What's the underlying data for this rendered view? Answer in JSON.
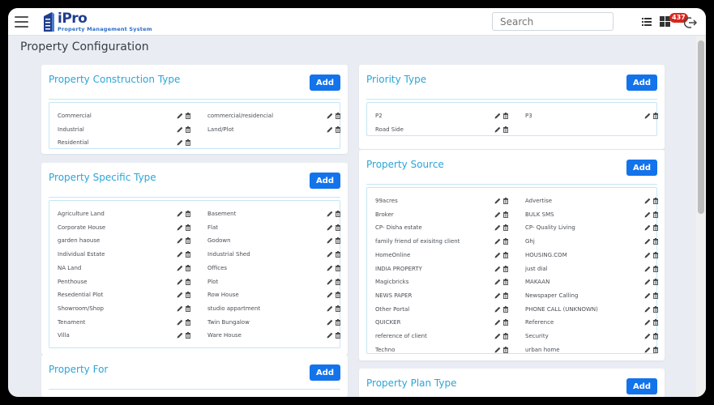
{
  "header": {
    "logo_name": "iPro",
    "logo_tagline": "Property Management System",
    "search_placeholder": "Search",
    "notification_count": "437"
  },
  "page": {
    "title": "Property Configuration"
  },
  "add_label": "Add",
  "cards": {
    "construction": {
      "title": "Property Construction Type",
      "items": [
        "Commercial",
        "commercial/residencial",
        "Industrial",
        "Land/Plot",
        "Residential"
      ]
    },
    "specific": {
      "title": "Property Specific Type",
      "items": [
        "Agriculture Land",
        "Basement",
        "Corporate House",
        "Flat",
        "garden haouse",
        "Godown",
        "Individual Estate",
        "Industrial Shed",
        "NA Land",
        "Offices",
        "Penthouse",
        "Plot",
        "Resedential Plot",
        "Row House",
        "Showroom/Shop",
        "studio appartment",
        "Tenament",
        "Twin Bungalow",
        "Villa",
        "Ware House"
      ]
    },
    "for": {
      "title": "Property For",
      "items": []
    },
    "priority": {
      "title": "Priority Type",
      "items": [
        "P2",
        "P3",
        "Road Side"
      ]
    },
    "source": {
      "title": "Property Source",
      "items": [
        "99acres",
        "Advertise",
        "Broker",
        "BULK SMS",
        "CP- Disha estate",
        "CP- Quality Living",
        "family friend of exisitng client",
        "Ghj",
        "HomeOnline",
        "HOUSING.COM",
        "INDIA PROPERTY",
        "just dial",
        "Magicbricks",
        "MAKAAN",
        "NEWS PAPER",
        "Newspaper Calling",
        "Other Portal",
        "PHONE CALL (UNKNOWN)",
        "QUICKER",
        "Reference",
        "reference of client",
        "Security",
        "Techno",
        "urban home"
      ]
    },
    "plan": {
      "title": "Property Plan Type",
      "items": []
    }
  },
  "icons": {
    "menu": "hamburger-icon",
    "list": "list-view-icon",
    "grid": "grid-view-icon",
    "logout": "logout-icon",
    "edit": "pencil-icon",
    "delete": "trash-icon"
  },
  "colors": {
    "accent": "#1273eb",
    "title": "#2ba5d8",
    "badge": "#d9251c",
    "background": "#e9edf3"
  }
}
